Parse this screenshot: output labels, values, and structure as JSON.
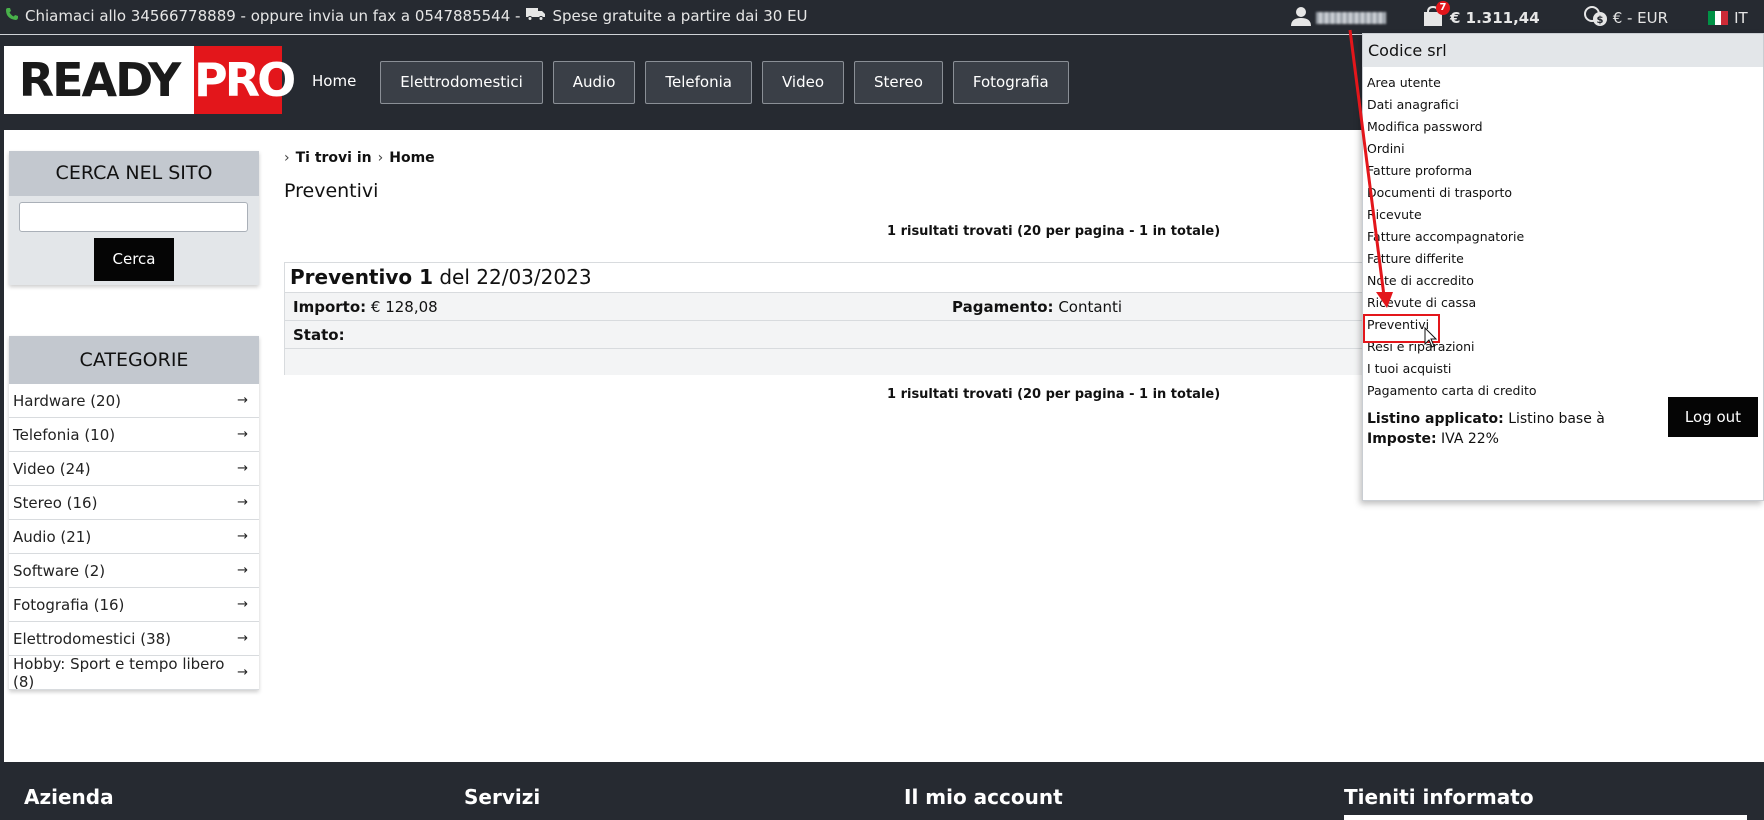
{
  "topbar": {
    "contact_text": "Chiamaci allo 34566778889 - oppure invia un fax a 0547885544 -",
    "shipping_text": "Spese gratuite a partire dai 30 EU",
    "cart_count": "7",
    "cart_total": "€ 1.311,44",
    "currency": "€ - EUR",
    "language": "IT"
  },
  "header": {
    "logo_ready": "READY",
    "logo_pro": "PRO",
    "nav": [
      "Home",
      "Elettrodomestici",
      "Audio",
      "Telefonia",
      "Video",
      "Stereo",
      "Fotografia"
    ]
  },
  "search": {
    "title": "CERCA NEL SITO",
    "button": "Cerca"
  },
  "categories": {
    "title": "CATEGORIE",
    "items": [
      "Hardware (20)",
      "Telefonia (10)",
      "Video (24)",
      "Stereo (16)",
      "Audio (21)",
      "Software (2)",
      "Fotografia (16)",
      "Elettrodomestici (38)",
      "Hobby: Sport e tempo libero (8)"
    ]
  },
  "main": {
    "breadcrumb_prefix": "Ti trovi in",
    "breadcrumb_current": "Home",
    "title": "Preventivi",
    "results_text": "1 risultati trovati (20 per pagina - 1 in totale)",
    "quote": {
      "name": "Preventivo 1",
      "date": "del 22/03/2023",
      "amount_label": "Importo:",
      "amount_value": "€ 128,08",
      "payment_label": "Pagamento:",
      "payment_value": "Contanti",
      "status_label": "Stato:"
    }
  },
  "dropdown": {
    "title": "Codice srl",
    "items": [
      "Area utente",
      "Dati anagrafici",
      "Modifica password",
      "Ordini",
      "Fatture proforma",
      "Documenti di trasporto",
      "Ricevute",
      "Fatture accompagnatorie",
      "Fatture differite",
      "Note di accredito",
      "Ricevute di cassa",
      "Preventivi",
      "Resi e riparazioni",
      "I tuoi acquisti",
      "Pagamento carta di credito"
    ],
    "listino_label": "Listino applicato:",
    "listino_value": "Listino base à",
    "imposte_label": "Imposte:",
    "imposte_value": "IVA 22%",
    "logout": "Log out"
  },
  "footer": {
    "columns": [
      "Azienda",
      "Servizi",
      "Il mio account",
      "Tieniti informato"
    ]
  },
  "colors": {
    "dark_bg": "#262a31",
    "brand_red": "#e3161b",
    "accent_black": "#050505"
  }
}
